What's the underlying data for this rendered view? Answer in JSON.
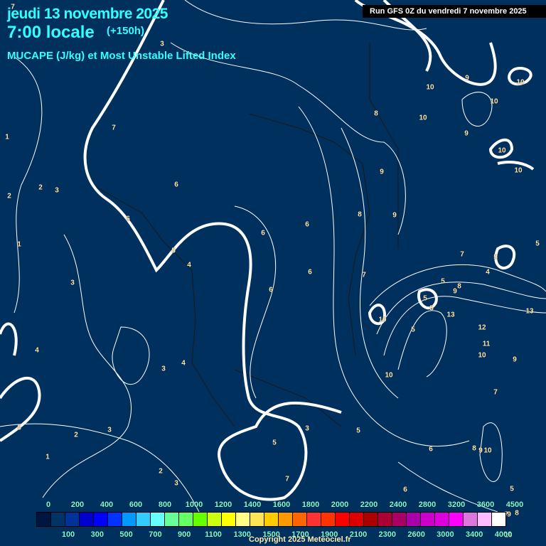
{
  "header": {
    "date": "jeudi 13 novembre 2025",
    "time": "7:00 locale",
    "lead": "(+150h)",
    "parameter": "MUCAPE (J/kg) et Most Unstable Lifted Index",
    "run": "Run GFS 0Z du vendredi 7 novembre 2025"
  },
  "contour_labels": [
    "7",
    "3",
    "1",
    "2",
    "3",
    "2",
    "1",
    "7",
    "6",
    "6",
    "5",
    "4",
    "3",
    "6",
    "6",
    "6",
    "6",
    "7",
    "8",
    "9",
    "9",
    "8",
    "10",
    "10",
    "9",
    "10",
    "9",
    "10",
    "10",
    "10",
    "7",
    "5",
    "5",
    "4",
    "5",
    "8",
    "9",
    "5",
    "5",
    "13",
    "13",
    "10",
    "5",
    "12",
    "11",
    "10",
    "9",
    "10",
    "7",
    "4",
    "3",
    "4",
    "5",
    "3",
    "2",
    "1",
    "3",
    "2",
    "3",
    "5",
    "5",
    "6",
    "7",
    "5",
    "8",
    "9",
    "10",
    "6",
    "7",
    "10",
    "9",
    "8"
  ],
  "legend": {
    "colors": [
      "#001540",
      "#003366",
      "#003399",
      "#0000cc",
      "#0000ff",
      "#0033ff",
      "#0099ff",
      "#33ccff",
      "#66ffff",
      "#66ff99",
      "#66ff66",
      "#66ff00",
      "#ccff11",
      "#ffff00",
      "#ffff88",
      "#ffe555",
      "#ffcc00",
      "#ff9900",
      "#ff6600",
      "#ff3333",
      "#ff3300",
      "#ff0000",
      "#dd0000",
      "#aa0000",
      "#aa0033",
      "#aa0066",
      "#aa00aa",
      "#cc00cc",
      "#dd00dd",
      "#ff00ff",
      "#dd77dd",
      "#ffbbff",
      "#ffffff"
    ],
    "top_labels": [
      "0",
      "200",
      "400",
      "600",
      "800",
      "1000",
      "1200",
      "1400",
      "1600",
      "1800",
      "2000",
      "2200",
      "2400",
      "2800",
      "3200",
      "3600",
      "4500"
    ],
    "bottom_labels": [
      "100",
      "300",
      "500",
      "700",
      "900",
      "1100",
      "1300",
      "1500",
      "1700",
      "1900",
      "2100",
      "2300",
      "2600",
      "3000",
      "3400",
      "4000"
    ]
  },
  "copyright": "Copyright 2025 Meteociel.fr"
}
